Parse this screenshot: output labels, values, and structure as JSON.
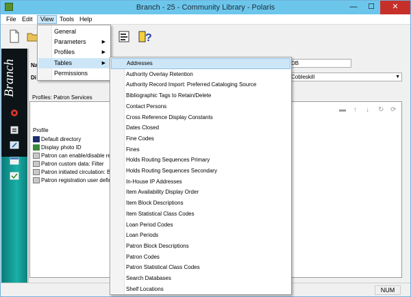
{
  "window": {
    "title": "Branch - 25 - Community Library - Polaris",
    "minimize_glyph": "—",
    "maximize_glyph": "☐",
    "close_glyph": "✕"
  },
  "menubar": {
    "items": [
      "File",
      "Edit",
      "View",
      "Tools",
      "Help"
    ],
    "active": "View"
  },
  "sidebar": {
    "label": "Branch"
  },
  "content": {
    "field_label_1": "Na",
    "field_label_2": "Di",
    "field_value_1": "DB",
    "combo_value": "Cobleskill",
    "panel_header": "Profiles: Patron Services",
    "column_header": "Profile",
    "profiles": [
      "Default directory",
      "Display photo ID",
      "Patron can enable/disable re",
      "Patron custom data: Filter",
      "Patron initiated circulation: Bl",
      "Patron registration user define"
    ]
  },
  "view_menu": {
    "items": [
      {
        "label": "General",
        "submenu": false
      },
      {
        "label": "Parameters",
        "submenu": true
      },
      {
        "label": "Profiles",
        "submenu": true
      },
      {
        "label": "Tables",
        "submenu": true
      },
      {
        "label": "Permissions",
        "submenu": false
      }
    ],
    "highlighted": "Tables",
    "arrow_glyph": "▶"
  },
  "tables_submenu": {
    "items": [
      "Addresses",
      "Authority Overlay Retention",
      "Authority Record Import: Preferred Cataloging Source",
      "Bibliographic Tags to Retain/Delete",
      "Contact Persons",
      "Cross Reference Display Constants",
      "Dates Closed",
      "Fine Codes",
      "Fines",
      "Holds Routing Sequences Primary",
      "Holds Routing Sequences Secondary",
      "In-House IP Addresses",
      "Item Availability Display Order",
      "Item Block Descriptions",
      "Item Statistical Class Codes",
      "Loan Period Codes",
      "Loan Periods",
      "Patron Block Descriptions",
      "Patron Codes",
      "Patron Statistical Class Codes",
      "Search Databases",
      "Shelf Locations"
    ],
    "highlighted": "Addresses"
  },
  "statusbar": {
    "num": "NUM"
  },
  "colors": {
    "titlebar": "#6cc6ec",
    "highlight": "#cde6f7",
    "close": "#c7302a"
  }
}
